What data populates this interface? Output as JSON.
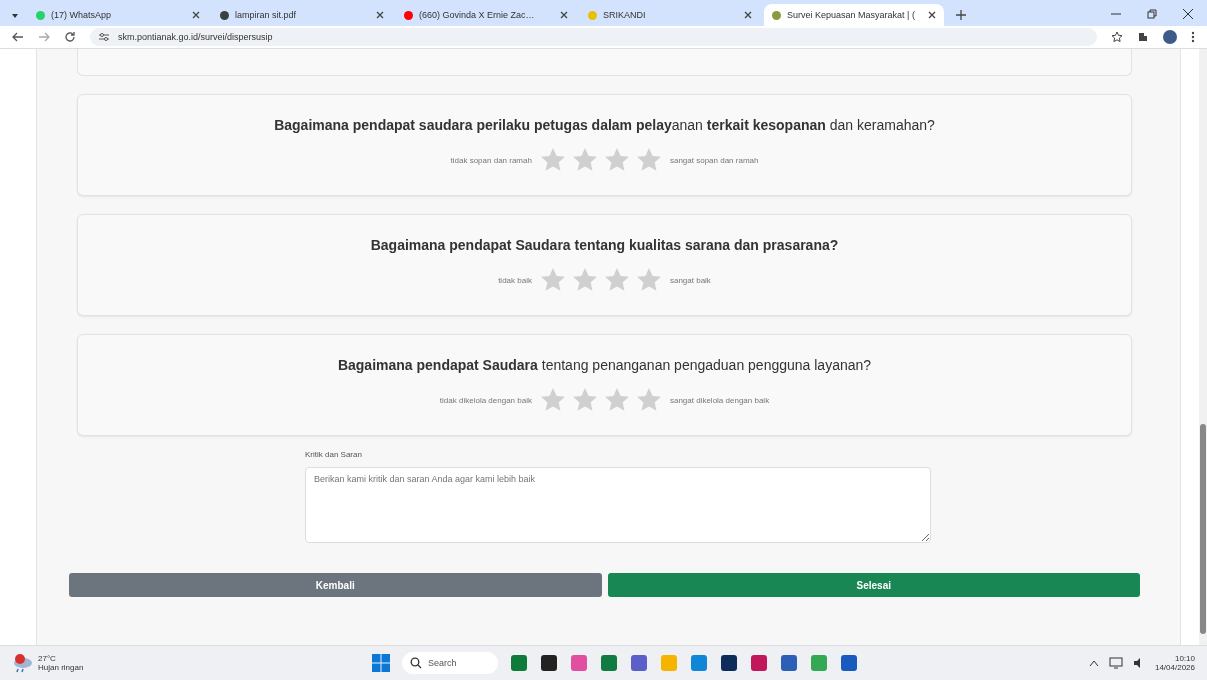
{
  "browser": {
    "tabs": [
      {
        "label": "(17) WhatsApp",
        "selected": false,
        "color": "#25d366"
      },
      {
        "label": "lampiran sit.pdf",
        "selected": false,
        "color": "#3c4043"
      },
      {
        "label": "(660) Govinda X Ernie Zac…",
        "selected": false,
        "color": "#ff0000"
      },
      {
        "label": "SRIKANDI",
        "selected": false,
        "color": "#e8c000"
      },
      {
        "label": "Survei Kepuasan Masyarakat | (",
        "selected": true,
        "color": "#8a9a40"
      }
    ],
    "url": "skm.pontianak.go.id/survei/dispersusip"
  },
  "questions": [
    {
      "text": "**Bagaimana pendapat saudara perilaku petugas dalam  pelay**anan **terkait kesopanan** dan keramahan?",
      "low": "tidak sopan dan ramah",
      "high": "sangat sopan dan ramah",
      "stars": 0
    },
    {
      "text": "**Bagaimana pendapat Saudara tentang kualitas sarana dan prasarana?**",
      "low": "tidak baik",
      "high": "sangat baik",
      "stars": 0
    },
    {
      "text": "**Bagaimana pendapat Saudara** tentang penanganan pengaduan pengguna layanan?",
      "low": "tidak dikelola dengan baik",
      "high": "sangat dikelola dengan baik",
      "stars": 0
    }
  ],
  "feedback": {
    "label": "Kritik dan Saran",
    "placeholder": "Berikan kami kritik dan saran Anda agar kami lebih baik"
  },
  "buttons": {
    "back": "Kembali",
    "finish": "Selesai"
  },
  "taskbar": {
    "temperature": "27°C",
    "weather": "Hujan ringan",
    "search": "Search",
    "time": "10:10",
    "date": "14/04/2026",
    "apps": [
      {
        "color": "#0f7b3b"
      },
      {
        "color": "#222222"
      },
      {
        "color": "#e04fa0"
      },
      {
        "color": "#107c41"
      },
      {
        "color": "#5b5fc7"
      },
      {
        "color": "#f4b400"
      },
      {
        "color": "#0f86d6"
      },
      {
        "color": "#0d2c5c"
      },
      {
        "color": "#c2185b"
      },
      {
        "color": "#2b5fb8"
      },
      {
        "color": "#34a853"
      },
      {
        "color": "#185abd"
      }
    ]
  }
}
